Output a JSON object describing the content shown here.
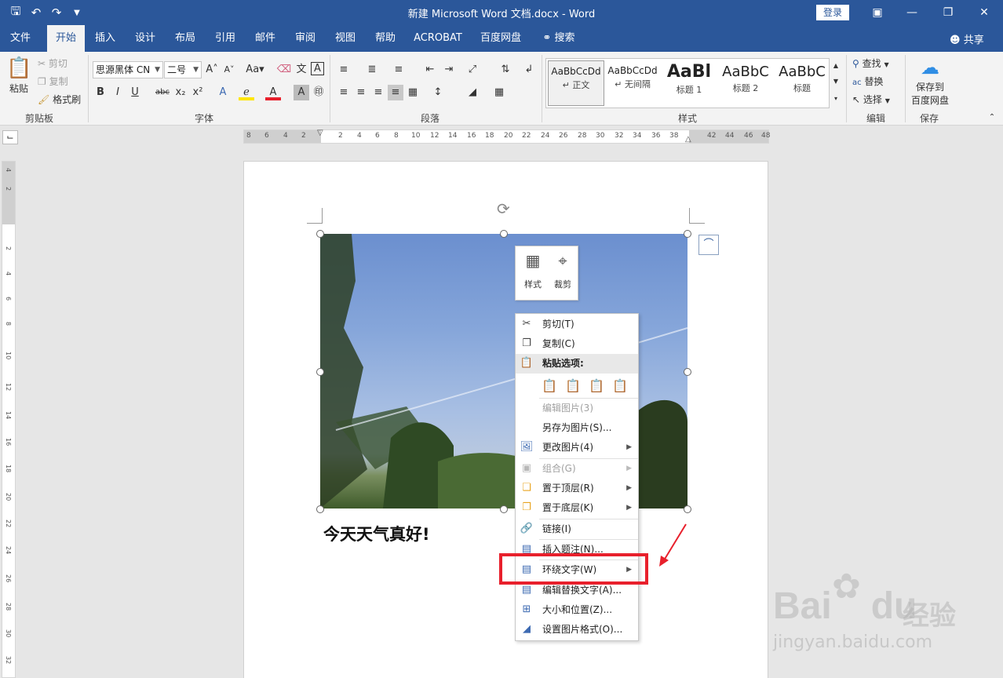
{
  "titlebar": {
    "title": "新建 Microsoft Word 文档.docx  -  Word",
    "login": "登录",
    "qat": [
      "save-icon",
      "undo-icon",
      "redo-icon",
      "customize-icon"
    ]
  },
  "tabs": [
    "文件",
    "开始",
    "插入",
    "设计",
    "布局",
    "引用",
    "邮件",
    "审阅",
    "视图",
    "帮助",
    "ACROBAT",
    "百度网盘",
    "搜索"
  ],
  "active_tab": "开始",
  "share": "共享",
  "ribbon": {
    "clipboard": {
      "paste": "粘贴",
      "cut": "剪切",
      "copy": "复制",
      "format_painter": "格式刷",
      "label": "剪贴板"
    },
    "font": {
      "font_name": "思源黑体 CN",
      "font_size": "二号",
      "label": "字体"
    },
    "paragraph": {
      "label": "段落"
    },
    "styles": {
      "label": "样式",
      "items": [
        {
          "sample": "AaBbCcDd",
          "name": "↵ 正文"
        },
        {
          "sample": "AaBbCcDd",
          "name": "↵ 无间隔"
        },
        {
          "sample": "AaBl",
          "name": "标题 1"
        },
        {
          "sample": "AaBbC",
          "name": "标题 2"
        },
        {
          "sample": "AaBbC",
          "name": "标题"
        }
      ]
    },
    "editing": {
      "find": "查找",
      "replace": "替换",
      "select": "选择",
      "label": "编辑"
    },
    "save": {
      "button_line1": "保存到",
      "button_line2": "百度网盘",
      "label": "保存"
    }
  },
  "hruler_numbers": [
    "8",
    "6",
    "4",
    "2",
    "",
    "2",
    "4",
    "6",
    "8",
    "10",
    "12",
    "14",
    "16",
    "18",
    "20",
    "22",
    "24",
    "26",
    "28",
    "30",
    "32",
    "34",
    "36",
    "38",
    "",
    "42",
    "44",
    "46",
    "48"
  ],
  "vruler_numbers": [
    "4",
    "2",
    "",
    "2",
    "4",
    "6",
    "8",
    "10",
    "12",
    "14",
    "16",
    "18",
    "20",
    "22",
    "24",
    "26",
    "28",
    "30",
    "32"
  ],
  "document": {
    "text": "今天天气真好!"
  },
  "mini_toolbar": {
    "style": "样式",
    "crop": "裁剪"
  },
  "context_menu": {
    "cut": "剪切(T)",
    "copy": "复制(C)",
    "paste_options": "粘贴选项:",
    "edit_picture": "编辑图片(3)",
    "save_as_picture": "另存为图片(S)...",
    "change_picture": "更改图片(4)",
    "group": "组合(G)",
    "bring_to_front": "置于顶层(R)",
    "send_to_back": "置于底层(K)",
    "link": "链接(I)",
    "insert_caption": "插入题注(N)...",
    "wrap_text": "环绕文字(W)",
    "edit_alt_text": "编辑替换文字(A)...",
    "size_position": "大小和位置(Z)...",
    "format_picture": "设置图片格式(O)..."
  },
  "watermark": {
    "logo": "Bai",
    "logo2": "du",
    "cn": "经验",
    "url": "jingyan.baidu.com"
  },
  "colors": {
    "brand": "#2b579a",
    "highlight": "#e8202c"
  }
}
